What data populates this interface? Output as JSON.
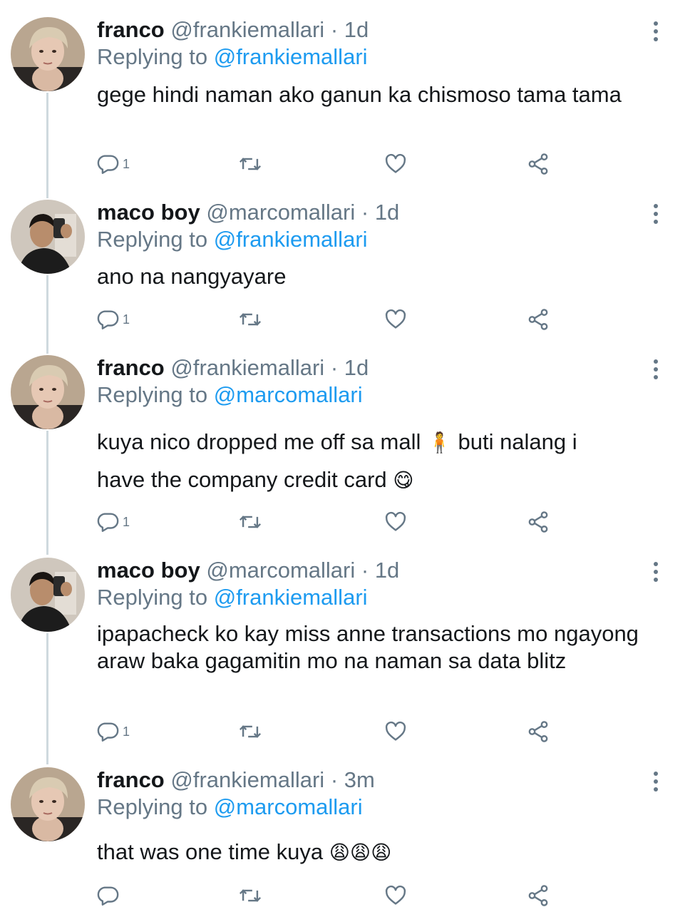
{
  "tweets": [
    {
      "name": "franco",
      "handle": "@frankiemallari",
      "dot": "·",
      "time": "1d",
      "reply_prefix": "Replying to",
      "reply_to": "@frankiemallari",
      "text": "gege hindi naman ako ganun ka chismoso tama tama",
      "reply_count": "1",
      "avatar": "franco-avatar"
    },
    {
      "name": "maco boy",
      "handle": "@marcomallari",
      "dot": "·",
      "time": "1d",
      "reply_prefix": "Replying to",
      "reply_to": "@frankiemallari",
      "text": "ano na nangyayare",
      "reply_count": "1",
      "avatar": "maco-avatar"
    },
    {
      "name": "franco",
      "handle": "@frankiemallari",
      "dot": "·",
      "time": "1d",
      "reply_prefix": "Replying to",
      "reply_to": "@marcomallari",
      "text_part1": "kuya nico dropped me off sa mall",
      "emoji1": "🧍",
      "text_part2": "buti nalang i",
      "text_part3": "have the company credit card",
      "emoji2": "😋",
      "reply_count": "1",
      "avatar": "franco-avatar"
    },
    {
      "name": "maco boy",
      "handle": "@marcomallari",
      "dot": "·",
      "time": "1d",
      "reply_prefix": "Replying to",
      "reply_to": "@frankiemallari",
      "text": "ipapacheck ko kay miss anne transactions mo ngayong araw baka gagamitin mo na naman sa data blitz",
      "reply_count": "1",
      "avatar": "maco-avatar"
    },
    {
      "name": "franco",
      "handle": "@frankiemallari",
      "dot": "·",
      "time": "3m",
      "reply_prefix": "Replying to",
      "reply_to": "@marcomallari",
      "text": "that was one time kuya",
      "emoji": "😩😩😩",
      "reply_count": "",
      "avatar": "franco-avatar"
    }
  ],
  "icons": {
    "reply": "reply-icon",
    "retweet": "retweet-icon",
    "like": "heart-icon",
    "share": "share-icon",
    "more": "more-vertical-icon"
  },
  "colors": {
    "link": "#1d9bf0",
    "muted": "#657786",
    "text": "#14171a",
    "thread_line": "#cfd9de"
  }
}
